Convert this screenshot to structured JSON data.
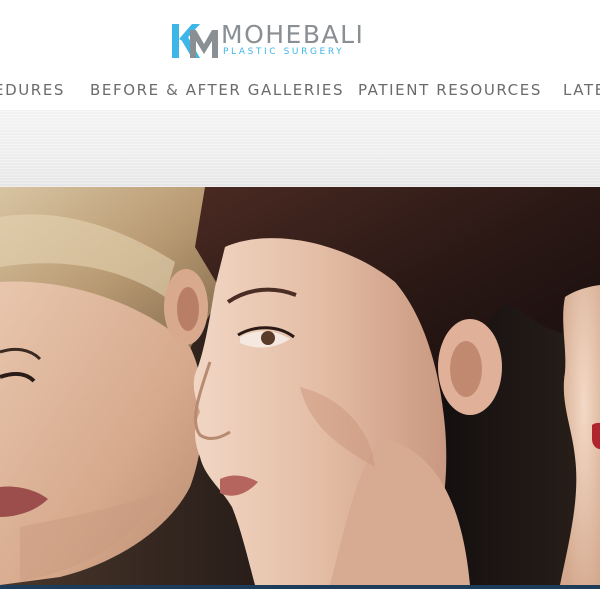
{
  "brand": {
    "name": "MOHEBALI",
    "subtitle": "PLASTIC SURGERY",
    "mark_colors": {
      "k": "#3fb6e8",
      "m": "#8a8f94"
    }
  },
  "nav": {
    "items": [
      {
        "label": "EDURES"
      },
      {
        "label": "BEFORE & AFTER GALLERIES"
      },
      {
        "label": "PATIENT RESOURCES"
      },
      {
        "label": "LATE"
      }
    ]
  },
  "colors": {
    "nav_text": "#6b6b6b",
    "accent_blue": "#3fb6e8",
    "footer_bar": "#1d3c5a"
  }
}
